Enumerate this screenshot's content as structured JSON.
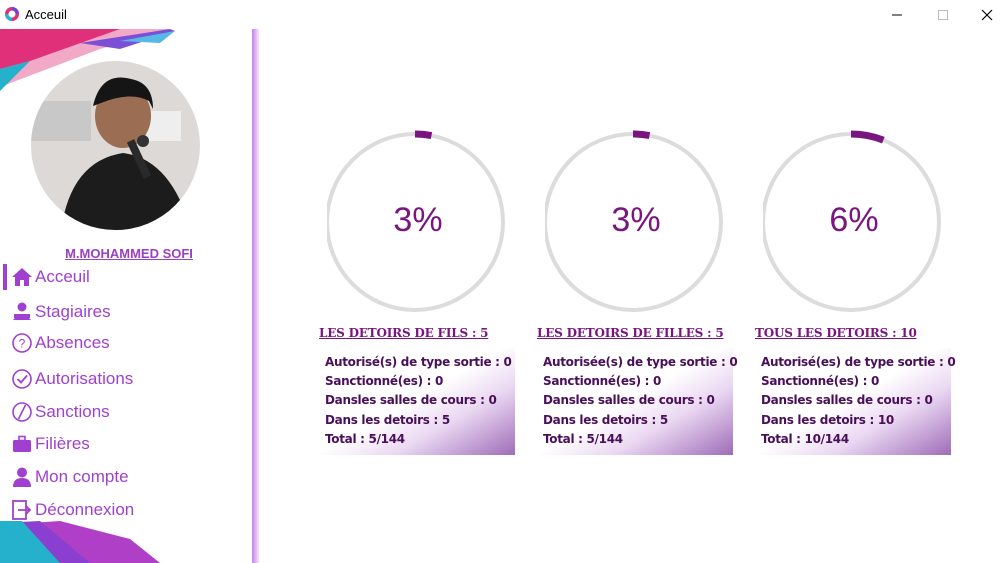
{
  "window": {
    "title": "Acceuil"
  },
  "user": {
    "name": "M.MOHAMMED SOFI"
  },
  "sidebar": {
    "items": [
      {
        "label": "Acceuil",
        "icon": "home-icon",
        "active": true
      },
      {
        "label": "Stagiaires",
        "icon": "user-lock-icon"
      },
      {
        "label": "Absences",
        "icon": "question-circle-icon"
      },
      {
        "label": "Autorisations",
        "icon": "check-circle-icon"
      },
      {
        "label": "Sanctions",
        "icon": "ban-icon"
      },
      {
        "label": "Filières",
        "icon": "briefcase-icon"
      },
      {
        "label": "Mon compte",
        "icon": "user-icon"
      },
      {
        "label": "Déconnexion",
        "icon": "logout-icon"
      }
    ]
  },
  "cards": [
    {
      "percent_text": "3%",
      "percent": 3,
      "title": "LES DETOIRS DE FILS : 5",
      "stats": [
        "Autorisé(s) de type sortie : 0",
        "Sanctionné(es) : 0",
        "Dansles salles de cours : 0",
        "Dans les detoirs : 5",
        "Total : 5/144"
      ]
    },
    {
      "percent_text": "3%",
      "percent": 3,
      "title": "LES DETOIRS DE FILLES : 5",
      "stats": [
        "Autorisée(s) de type sortie : 0",
        "Sanctionné(es) : 0",
        "Dansles salles de cours : 0",
        "Dans les detoirs : 5",
        "Total : 5/144"
      ]
    },
    {
      "percent_text": "6%",
      "percent": 6,
      "title": "TOUS LES DETOIRS : 10",
      "stats": [
        "Autorisé(es) de type sortie : 0",
        "Sanctionné(es) : 0",
        "Dansles salles de cours : 0",
        "Dans les detoirs : 10",
        "Total : 10/144"
      ]
    }
  ],
  "colors": {
    "accent": "#a040d0",
    "ring_progress": "#7a1580",
    "ring_track": "#dcdcdc"
  }
}
